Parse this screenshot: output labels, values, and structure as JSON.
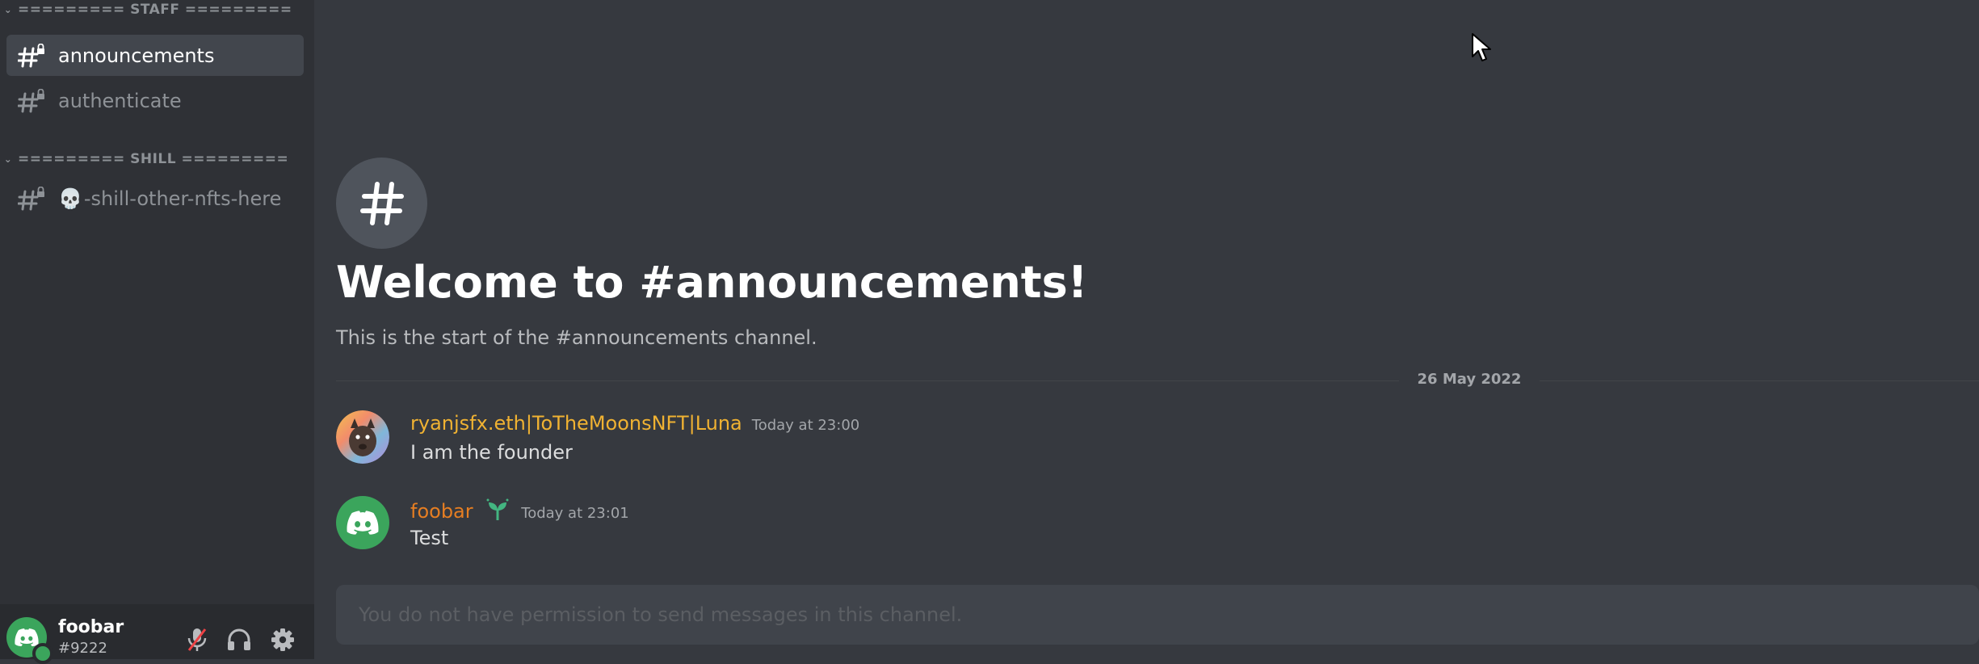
{
  "sidebar": {
    "categories": [
      {
        "label": "========= STAFF ========="
      },
      {
        "label": "========= SHILL ========="
      }
    ],
    "channels": [
      {
        "label": "announcements"
      },
      {
        "label": "authenticate"
      },
      {
        "label": "-shill-other-nfts-here",
        "prefix_emoji": "💀"
      }
    ]
  },
  "user_panel": {
    "username": "foobar",
    "tag": "#9222",
    "status_color": "#3ba55c"
  },
  "main": {
    "welcome_title": "Welcome to #announcements!",
    "welcome_subtitle": "This is the start of the #announcements channel.",
    "date_divider": "26 May 2022",
    "messages": [
      {
        "author": "ryanjsfx.eth|ToTheMoonsNFT|Luna",
        "author_color": "#f0b232",
        "time": "Today at 23:00",
        "content": "I am the founder"
      },
      {
        "author": "foobar",
        "author_color": "#e67e22",
        "badge": "sprout",
        "time": "Today at 23:01",
        "content": "Test"
      }
    ],
    "composer_placeholder": "You do not have permission to send messages in this channel."
  },
  "colors": {
    "background": "#36393f",
    "sidebar": "#2f3136",
    "user_panel": "#292b2f",
    "active_channel": "#42464d",
    "accent_green": "#3ba55c",
    "muted_red": "#ed4245"
  }
}
